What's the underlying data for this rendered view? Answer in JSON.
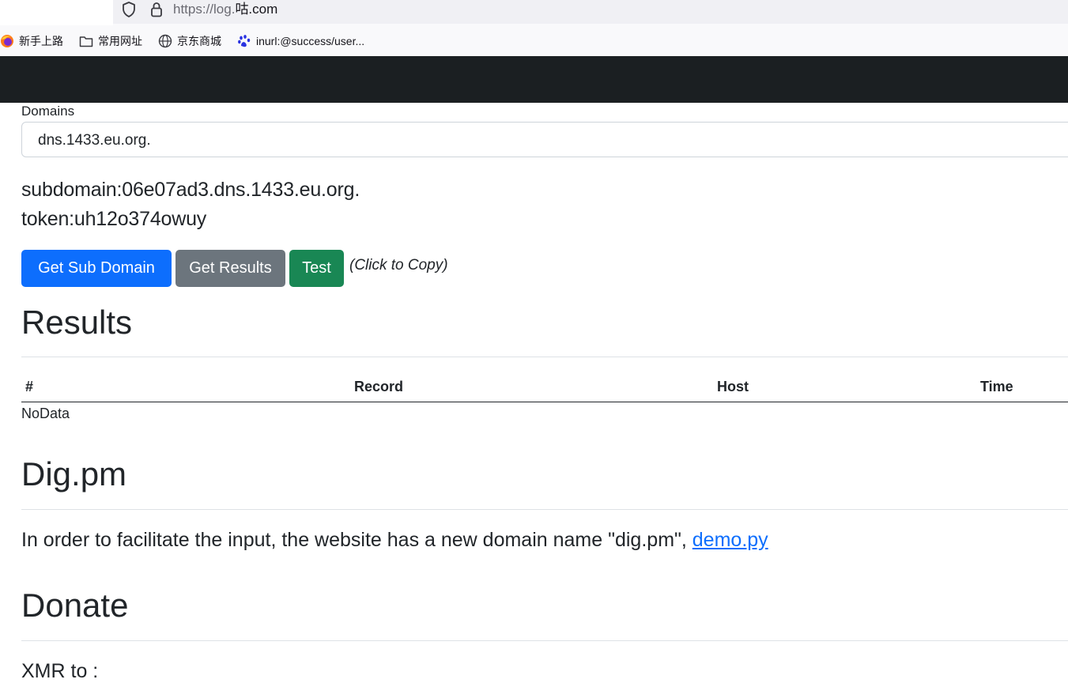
{
  "browser": {
    "url_prefix": "https://log.",
    "url_host": "咕.com",
    "bookmarks": [
      {
        "label": "新手上路",
        "icon": "firefox-icon"
      },
      {
        "label": "常用网址",
        "icon": "folder-icon"
      },
      {
        "label": "京东商城",
        "icon": "globe-icon"
      },
      {
        "label": "inurl:@success/user...",
        "icon": "baidu-paw-icon"
      }
    ]
  },
  "form": {
    "domains_label": "Domains",
    "domain_selected": "dns.1433.eu.org."
  },
  "info": {
    "subdomain": "subdomain:06e07ad3.dns.1433.eu.org.",
    "token": "token:uh12o374owuy"
  },
  "buttons": {
    "get_sub_domain": "Get Sub Domain",
    "get_results": "Get Results",
    "test": "Test",
    "copy_hint": "(Click to Copy)"
  },
  "results": {
    "heading": "Results",
    "columns": [
      "#",
      "Record",
      "Host",
      "Time"
    ],
    "empty_text": "NoData"
  },
  "digpm": {
    "heading": "Dig.pm",
    "text": "In order to facilitate the input, the website has a new domain name \"dig.pm\", ",
    "link_text": "demo.py"
  },
  "donate": {
    "heading": "Donate",
    "xmr_label": "XMR to :"
  },
  "colors": {
    "primary": "#0d6efd",
    "secondary": "#6c757d",
    "success": "#198754",
    "navbar": "#1b1f22"
  }
}
